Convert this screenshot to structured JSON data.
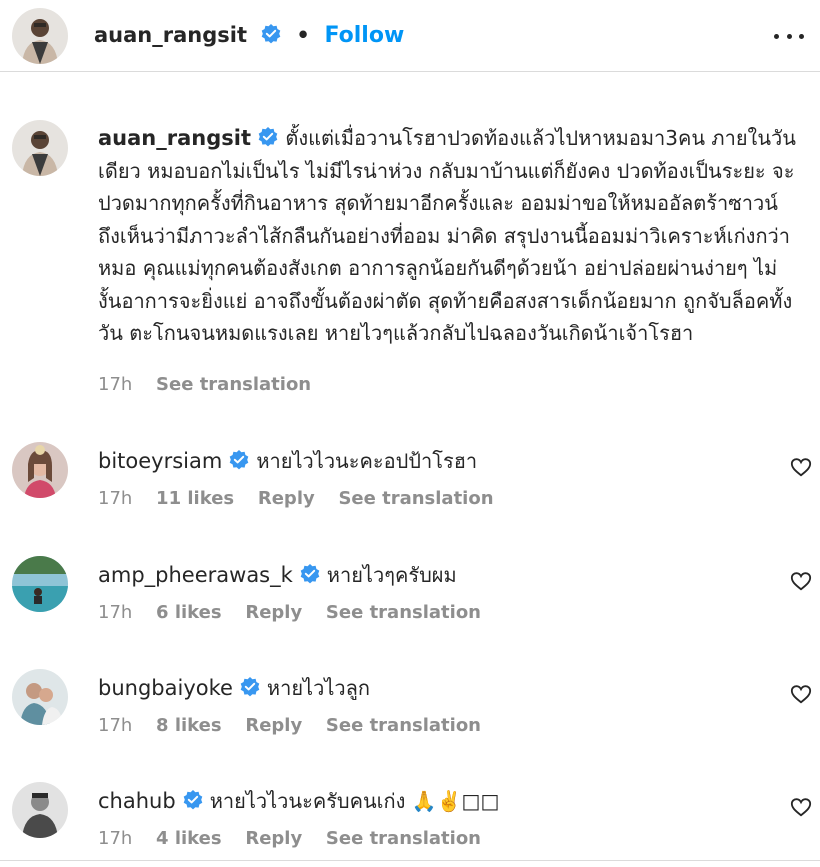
{
  "header": {
    "username": "auan_rangsit",
    "separator": "•",
    "follow_label": "Follow",
    "more_icon": "more-horizontal-icon"
  },
  "caption": {
    "username": "auan_rangsit",
    "text": "ตั้งแต่เมื่อวานโรฮาปวดท้องแล้วไปหาหมอมา3คน ภายในวันเดียว หมอบอกไม่เป็นไร ไม่มีไรน่าห่วง กลับมาบ้านแต่ก็ยังคง ปวดท้องเป็นระยะ จะปวดมากทุกครั้งที่กินอาหาร สุดท้ายมาอีกครั้งและ ออมม่าขอให้หมออัลตร้าซาวน์ถึงเห็นว่ามีภาวะลำไส้กลืนกันอย่างที่ออม ม่าคิด สรุปงานนี้ออมม่าวิเคราะห์เก่งกว่าหมอ คุณแม่ทุกคนต้องสังเกต อาการลูกน้อยกันดีๆด้วยน้า อย่าปล่อยผ่านง่ายๆ ไม่งั้นอาการจะยิ่งแย่ อาจถึงขั้นต้องผ่าตัด สุดท้ายคือสงสารเด็กน้อยมาก ถูกจับล็อคทั้งวัน ตะโกนจนหมดแรงเลย หายไวๆแล้วกลับไปฉลองวันเกิดน้าเจ้าโรฮา",
    "time": "17h",
    "see_translation": "See translation"
  },
  "comments": [
    {
      "username": "bitoeyrsiam",
      "text": "หายไวไวนะคะอปป้าโรฮา",
      "time": "17h",
      "likes": "11 likes",
      "reply": "Reply",
      "see_translation": "See translation"
    },
    {
      "username": "amp_pheerawas_k",
      "text": "หายไวๆครับผม",
      "time": "17h",
      "likes": "6 likes",
      "reply": "Reply",
      "see_translation": "See translation"
    },
    {
      "username": "bungbaiyoke",
      "text": "หายไวไวลูก",
      "time": "17h",
      "likes": "8 likes",
      "reply": "Reply",
      "see_translation": "See translation"
    },
    {
      "username": "chahub",
      "text": "หายไวไวนะครับคนเก่ง 🙏✌️□□",
      "time": "17h",
      "likes": "4 likes",
      "reply": "Reply",
      "see_translation": "See translation"
    }
  ],
  "colors": {
    "accent": "#0095f6",
    "verified": "#3897f0",
    "muted": "#8e8e8e",
    "text": "#262626"
  },
  "icons": {
    "verified": "verified-badge-icon",
    "heart": "heart-outline-icon"
  }
}
